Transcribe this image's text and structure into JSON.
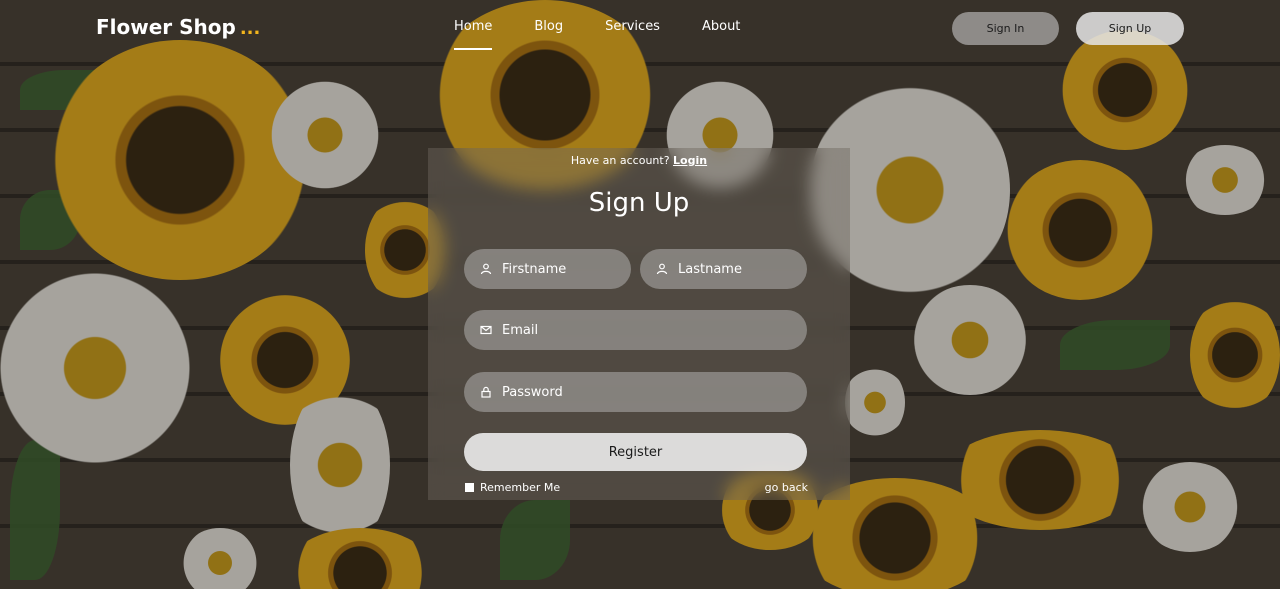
{
  "brand": {
    "name": "Flower Shop",
    "dots": "..."
  },
  "nav": {
    "links": [
      "Home",
      "Blog",
      "Services",
      "About"
    ],
    "sign_in": "Sign In",
    "sign_up": "Sign Up"
  },
  "form": {
    "prompt": "Have an account?",
    "login_link": "Login",
    "title": "Sign Up",
    "firstname_placeholder": "Firstname",
    "lastname_placeholder": "Lastname",
    "email_placeholder": "Email",
    "password_placeholder": "Password",
    "register_label": "Register",
    "remember_label": "Remember Me",
    "go_back_label": "go back"
  },
  "colors": {
    "accent": "#f2b51d"
  },
  "icons": {
    "firstname": "user-icon",
    "lastname": "user-icon",
    "email": "mail-icon",
    "password": "lock-icon"
  }
}
